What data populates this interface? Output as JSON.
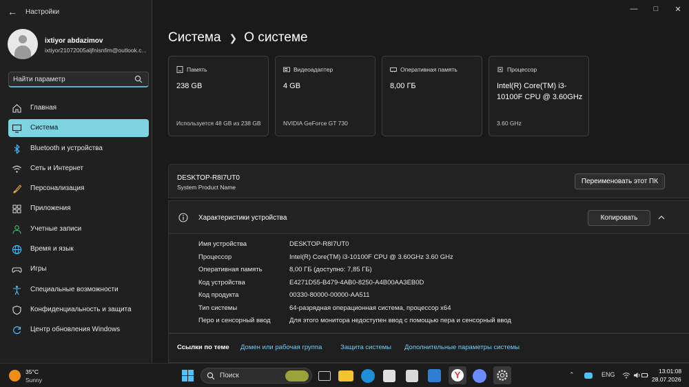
{
  "window": {
    "title": "Настройки",
    "controls": [
      "minimize",
      "maximize",
      "close"
    ]
  },
  "profile": {
    "name": "ixtiyor abdazimov",
    "email": "ixtiyor21072005aljfnisnfim@outlook.c..."
  },
  "search": {
    "placeholder": "Найти параметр"
  },
  "sidebar": {
    "items": [
      {
        "label": "Главная",
        "icon": "home-icon"
      },
      {
        "label": "Система",
        "icon": "system-icon",
        "active": true
      },
      {
        "label": "Bluetooth и устройства",
        "icon": "bluetooth-icon"
      },
      {
        "label": "Сеть и Интернет",
        "icon": "wifi-icon"
      },
      {
        "label": "Персонализация",
        "icon": "brush-icon"
      },
      {
        "label": "Приложения",
        "icon": "apps-icon"
      },
      {
        "label": "Учетные записи",
        "icon": "person-icon"
      },
      {
        "label": "Время и язык",
        "icon": "globe-icon"
      },
      {
        "label": "Игры",
        "icon": "gamepad-icon"
      },
      {
        "label": "Специальные возможности",
        "icon": "accessibility-icon"
      },
      {
        "label": "Конфиденциальность и защита",
        "icon": "shield-icon"
      },
      {
        "label": "Центр обновления Windows",
        "icon": "update-icon"
      }
    ]
  },
  "breadcrumb": {
    "parent": "Система",
    "current": "О системе"
  },
  "cards": [
    {
      "title": "Память",
      "value": "238 GB",
      "sub": "Используется 48 GB из 238 GB",
      "icon": "storage-icon"
    },
    {
      "title": "Видеоадаптер",
      "value": "4 GB",
      "sub": "NVIDIA GeForce GT 730",
      "icon": "gpu-icon"
    },
    {
      "title": "Оперативная память",
      "value": "8,00 ГБ",
      "sub": "",
      "icon": "ram-icon"
    },
    {
      "title": "Процессор",
      "value": "Intel(R) Core(TM) i3-10100F CPU @ 3.60GHz",
      "sub": "3.60 GHz",
      "icon": "cpu-icon"
    }
  ],
  "pc": {
    "name": "DESKTOP-R8I7UT0",
    "sub": "System Product Name",
    "rename_label": "Переименовать этот ПК"
  },
  "specs": {
    "title": "Характеристики устройства",
    "copy_label": "Копировать",
    "rows": [
      {
        "key": "Имя устройства",
        "value": "DESKTOP-R8I7UT0"
      },
      {
        "key": "Процессор",
        "value": "Intel(R) Core(TM) i3-10100F CPU @ 3.60GHz   3.60 GHz"
      },
      {
        "key": "Оперативная память",
        "value": "8,00 ГБ (доступно: 7,85 ГБ)"
      },
      {
        "key": "Код устройства",
        "value": "E4271D55-B479-4AB0-8250-A4B00AA3EB0D"
      },
      {
        "key": "Код продукта",
        "value": "00330-80000-00000-AA511"
      },
      {
        "key": "Тип системы",
        "value": "64-разрядная операционная система, процессор x64"
      },
      {
        "key": "Перо и сенсорный ввод",
        "value": "Для этого монитора недоступен ввод с помощью пера и сенсорный ввод"
      }
    ]
  },
  "related": {
    "title": "Ссылки по теме",
    "links": [
      "Домен или рабочая группа",
      "Защита системы",
      "Дополнительные параметры системы"
    ]
  },
  "taskbar": {
    "weather_temp": "35°C",
    "weather_desc": "Sunny",
    "search_label": "Поиск",
    "lang": "ENG",
    "time": "13:01:08",
    "date": "28.07.2026"
  },
  "colors": {
    "accent": "#7dd3df",
    "link": "#7fc9ea",
    "window_bg": "#1a1a1a",
    "sidebar_bg": "#202020"
  }
}
